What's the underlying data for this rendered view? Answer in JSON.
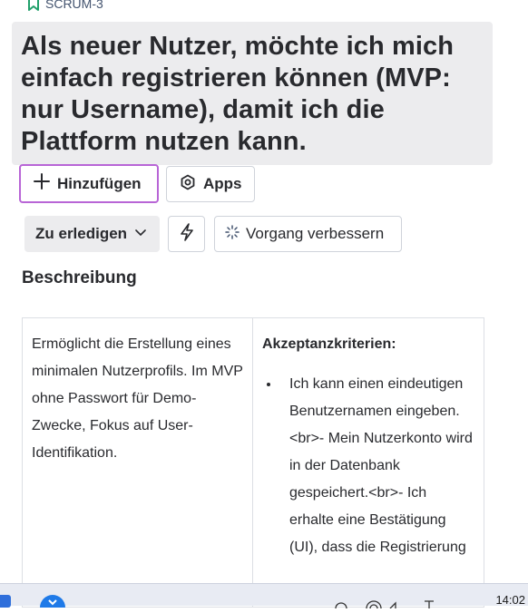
{
  "issue": {
    "key": "SCRUM-3",
    "title": "Als neuer Nutzer, möchte ich mich einfach registrieren können (MVP: nur Username), damit ich die Plattform nutzen kann."
  },
  "actions": {
    "add_label": "Hinzufügen",
    "apps_label": "Apps",
    "status_label": "Zu erledigen",
    "improve_label": "Vorgang verbessern"
  },
  "description": {
    "heading": "Beschreibung",
    "left_text": "Ermöglicht die Erstellung eines minimalen Nutzerprofils. Im MVP ohne Passwort für Demo-Zwecke, Fokus auf User-Identifikation.",
    "criteria_title": "Akzeptanzkriterien:",
    "criteria_item": "Ich kann einen eindeutigen Benutzernamen eingeben.<br>- Mein Nutzerkonto wird in der Datenbank gespeichert.<br>- Ich erhalte eine Bestätigung (UI), dass die Registrierung"
  },
  "taskbar": {
    "time": "14:02"
  },
  "icons": {
    "issue_type": "bookmark-icon",
    "add": "plus-icon",
    "apps": "hexagon-gear-icon",
    "status": "chevron-down-icon",
    "automation": "lightning-icon",
    "improve": "sparkle-icon"
  },
  "colors": {
    "focus_border": "#b865d6",
    "title_background": "#ececee",
    "issue_type_icon": "#22a06b"
  }
}
